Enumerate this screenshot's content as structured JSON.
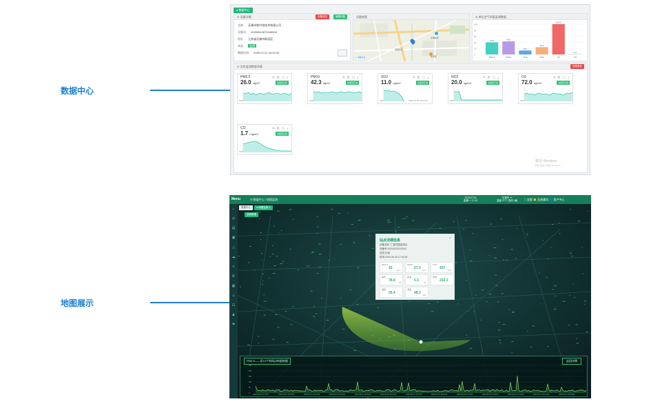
{
  "callouts": {
    "data_center": "数据中心",
    "map_display": "地图展示"
  },
  "shot1": {
    "tab": "● 数据中心",
    "device_panel": {
      "title": "① 设备详情",
      "btn_red": "设备监控",
      "btn_green": "编辑设备",
      "rows": [
        {
          "label": "名称:",
          "value": "无锡市和兴电技术有限公司"
        },
        {
          "label": "设备号:",
          "value": "20200613071040004"
        },
        {
          "label": "地址:",
          "value": "江苏省无锡市新吴区"
        },
        {
          "label": "状态:",
          "value": "在线"
        },
        {
          "label": "数据时间:",
          "value": "2020-07-21 16:22:32"
        }
      ]
    },
    "map_panel": {
      "title": "设备地图",
      "labels": [
        "无锡新区",
        "硕放机场",
        "新吴区"
      ],
      "legend": "● 地图标签"
    },
    "bar_panel": {
      "title": "① 单位空气质量监测数据",
      "yticks": [
        "100",
        "80",
        "60",
        "40",
        "20",
        "0"
      ]
    },
    "realtime_title": "① 实时监测数据详情",
    "realtime_btn": "查看更多",
    "cards": [
      {
        "name": "PM2.5",
        "value": "26.0",
        "unit": "ug/m³",
        "status": "浓度值正常",
        "t1": "2020-07-21 15:22:02",
        "t2": "2020-07-21 16:04:02"
      },
      {
        "name": "PM10",
        "value": "42.3",
        "unit": "ug/m³",
        "status": "浓度值正常",
        "t1": "2020-07-21 15:22:02",
        "t2": "2020-07-21 16:04:02"
      },
      {
        "name": "SO2",
        "value": "11.0",
        "unit": "ug/m3",
        "status": "浓度值正常",
        "t1": "2020-07-21 15:22:02",
        "t2": "2020-07-21 16:04:02"
      },
      {
        "name": "NO2",
        "value": "20.0",
        "unit": "ug/m3",
        "status": "浓度值正常",
        "t1": "2020-07-21 15:22:02",
        "t2": "2020-07-21 16:04:02"
      },
      {
        "name": "O3",
        "value": "72.0",
        "unit": "ug/m3",
        "status": "浓度值正常",
        "t1": "2020-07-21 15:22:02",
        "t2": "2020-07-21 16:04:02"
      },
      {
        "name": "CO",
        "value": "1.7",
        "unit": "mg/m3",
        "status": "浓度值正常",
        "t1": "2020-07-21 15:22:02",
        "t2": "2020-07-21 16:04:02"
      }
    ],
    "watermark": [
      "激活 Windows",
      "转到\"设置\"以激活 Windows。"
    ]
  },
  "chart_data": {
    "type": "bar",
    "categories": [
      "PM2.5",
      "PM10",
      "SO2",
      "NO2",
      "O3",
      "CO"
    ],
    "values": [
      40.0,
      43.0,
      13.0,
      24.0,
      100.0,
      1.0
    ],
    "value_labels": [
      "40.0",
      "43.0",
      "13.0",
      "24.0",
      "100.0",
      "1.0"
    ],
    "colors": [
      "#45d1c4",
      "#b79be6",
      "#5aa7ea",
      "#f7b07a",
      "#f06767",
      "#9ad1a8"
    ],
    "ylim": [
      0,
      100
    ]
  },
  "shot2": {
    "menu": "Menu",
    "breadcrumb": "☰  数据中心 / 地图监测",
    "date": [
      "2020/07/21",
      "星期一 17:02"
    ],
    "weather": [
      "无锡市 ☀",
      "温度 27℃ 西风 3级"
    ],
    "tools": "⛶ 全屏   🔔 无线通讯   👤 用户中心",
    "tabs": [
      "数据中心",
      "● 地图监测 ✕"
    ],
    "data_select": "选择数据",
    "popup": {
      "title": "站点详细信息",
      "lines": [
        "设备名称: 仁爱花园监测点",
        "设备号:20200523033004",
        "状态:在线",
        "时间:2020-06-15 17:02:02"
      ],
      "metrics": [
        {
          "label": "PM2.5",
          "value": "43",
          "unit": "ug/m³"
        },
        {
          "label": "PM10",
          "value": "57.0",
          "unit": "ug/m³"
        },
        {
          "label": "TSP",
          "value": "437",
          "unit": "ug/m³"
        },
        {
          "label": "噪声",
          "value": "78.8",
          "unit": "dB"
        },
        {
          "label": "风速",
          "value": "0.3",
          "unit": "m/s"
        },
        {
          "label": "风向",
          "value": "232.2",
          "unit": "°"
        },
        {
          "label": "温度",
          "value": "26.4",
          "unit": "℃"
        },
        {
          "label": "湿度",
          "value": "48.2",
          "unit": "%RH"
        }
      ]
    },
    "trend": {
      "title": "PM2.5——近12个时间点的趋势图",
      "button": "返回详情",
      "yticks": [
        "250",
        "200",
        "150",
        "100",
        "50",
        "0"
      ],
      "xticks": [
        "2020-06-15 17:00:00",
        "2020-06-15 14:54:00",
        "2020-06-15 15:14:00",
        "2020-06-15 15:34:00",
        "2020-06-15 15:54:00",
        "2020-06-15 16:14:00",
        "2020-06-15 16:34:00",
        "2020-06-15 16:54:00",
        "2020-06-15 17:14:00",
        "2020-06-15 17:34:00",
        "2020-06-15 17:54:00",
        "2020-06-15 18:14:00",
        "2020-06-15 18:34:00"
      ]
    }
  }
}
